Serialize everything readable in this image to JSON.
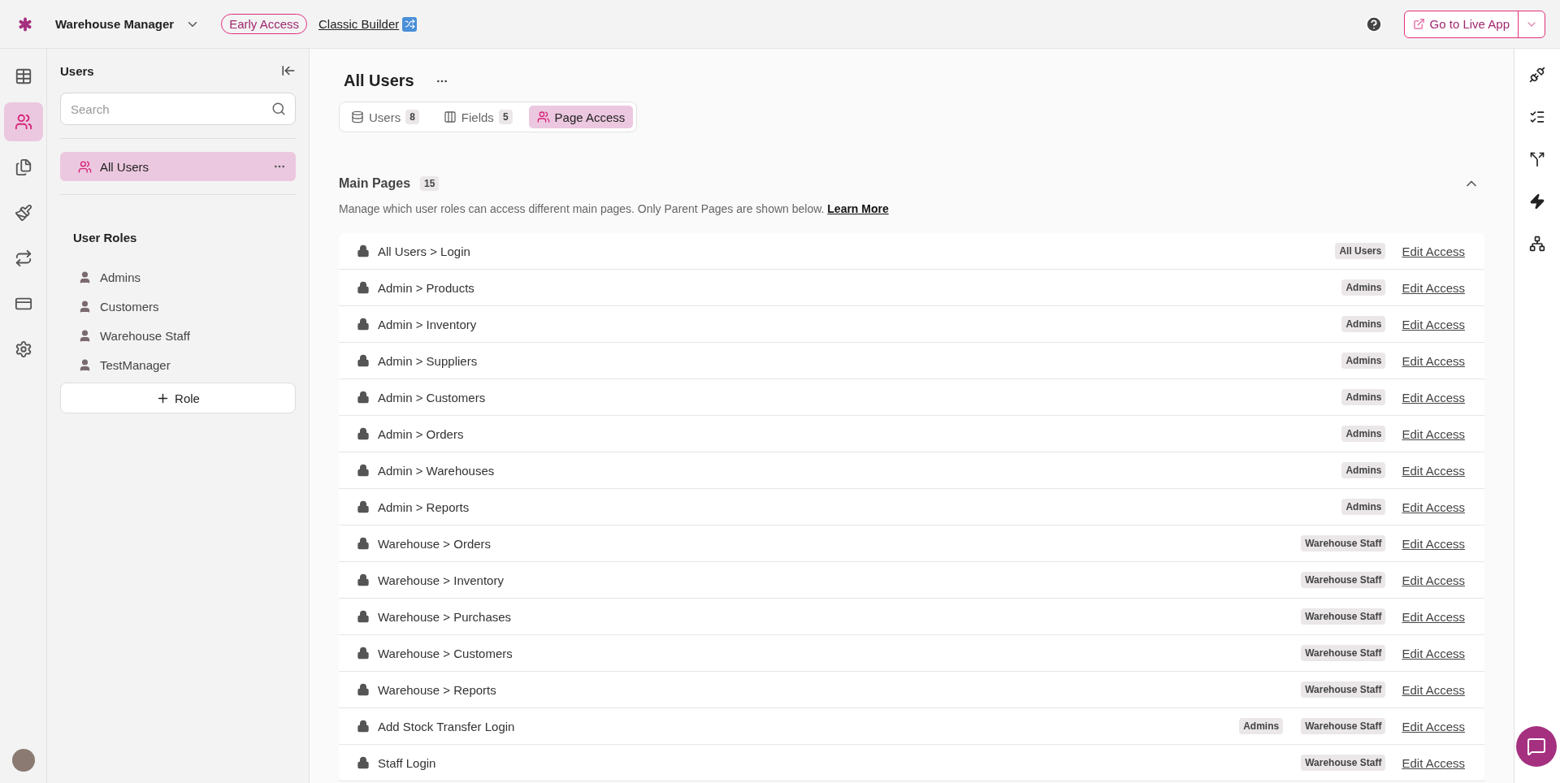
{
  "topbar": {
    "app_name": "Warehouse Manager",
    "badge": "Early Access",
    "builder_link": "Classic Builder",
    "live_button": "Go to Live App"
  },
  "left_rail": [
    {
      "kind": "table",
      "selected": false
    },
    {
      "kind": "users",
      "selected": true
    },
    {
      "kind": "pages",
      "selected": false
    },
    {
      "kind": "brush",
      "selected": false
    },
    {
      "kind": "logic",
      "selected": false
    },
    {
      "kind": "card",
      "selected": false
    },
    {
      "kind": "settings",
      "selected": false
    }
  ],
  "sidebar": {
    "title": "Users",
    "search": {
      "placeholder": "Search"
    },
    "groups": [
      {
        "label": "All Users",
        "selected": true
      }
    ],
    "roles_title": "User Roles",
    "roles": [
      {
        "label": "Admins",
        "selected": false
      },
      {
        "label": "Customers",
        "selected": false
      },
      {
        "label": "Warehouse Staff",
        "selected": false
      },
      {
        "label": "TestManager",
        "selected": false
      }
    ],
    "add_button": "Role"
  },
  "main": {
    "title": "All Users",
    "tabs": [
      {
        "kind": "database",
        "label": "Users",
        "count": "8",
        "selected": false
      },
      {
        "kind": "columns",
        "label": "Fields",
        "count": "5",
        "selected": false
      },
      {
        "kind": "users",
        "label": "Page Access",
        "selected": true
      }
    ],
    "section": {
      "title": "Main Pages",
      "count": "15",
      "expanded": true,
      "description": "Manage which user roles can access different main pages. Only Parent Pages are shown below.",
      "link": "Learn More",
      "rows": [
        {
          "name": "All Users > Login",
          "roles": [
            "All Users"
          ],
          "action": "Edit Access"
        },
        {
          "name": "Admin > Products",
          "roles": [
            "Admins"
          ],
          "action": "Edit Access"
        },
        {
          "name": "Admin > Inventory",
          "roles": [
            "Admins"
          ],
          "action": "Edit Access"
        },
        {
          "name": "Admin > Suppliers",
          "roles": [
            "Admins"
          ],
          "action": "Edit Access"
        },
        {
          "name": "Admin > Customers",
          "roles": [
            "Admins"
          ],
          "action": "Edit Access"
        },
        {
          "name": "Admin > Orders",
          "roles": [
            "Admins"
          ],
          "action": "Edit Access"
        },
        {
          "name": "Admin > Warehouses",
          "roles": [
            "Admins"
          ],
          "action": "Edit Access"
        },
        {
          "name": "Admin > Reports",
          "roles": [
            "Admins"
          ],
          "action": "Edit Access"
        },
        {
          "name": "Warehouse > Orders",
          "roles": [
            "Warehouse Staff"
          ],
          "action": "Edit Access"
        },
        {
          "name": "Warehouse > Inventory",
          "roles": [
            "Warehouse Staff"
          ],
          "action": "Edit Access"
        },
        {
          "name": "Warehouse > Purchases",
          "roles": [
            "Warehouse Staff"
          ],
          "action": "Edit Access"
        },
        {
          "name": "Warehouse > Customers",
          "roles": [
            "Warehouse Staff"
          ],
          "action": "Edit Access"
        },
        {
          "name": "Warehouse > Reports",
          "roles": [
            "Warehouse Staff"
          ],
          "action": "Edit Access"
        },
        {
          "name": "Add Stock Transfer Login",
          "roles": [
            "Admins",
            "Warehouse Staff"
          ],
          "action": "Edit Access"
        },
        {
          "name": "Staff Login",
          "roles": [
            "Warehouse Staff"
          ],
          "action": "Edit Access"
        }
      ]
    }
  },
  "right_rail": [
    {
      "kind": "plug"
    },
    {
      "kind": "list-check"
    },
    {
      "kind": "split"
    },
    {
      "kind": "zap"
    },
    {
      "kind": "network"
    }
  ]
}
